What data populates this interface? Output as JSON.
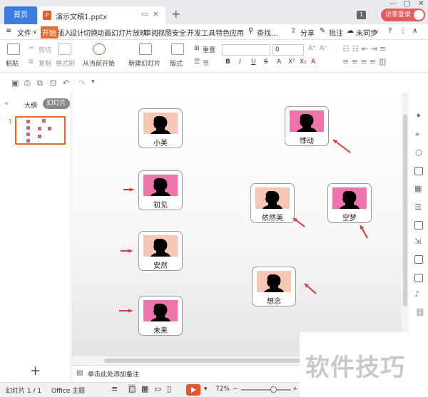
{
  "titlebar": {
    "home_tab": "首页",
    "doc_tab": "演示文稿1.pptx",
    "window_badge": "1",
    "login": "访客登录"
  },
  "menu": {
    "file": "文件",
    "items": [
      "开始",
      "插入",
      "设计",
      "切换",
      "动画",
      "幻灯片放映",
      "审阅",
      "视图",
      "安全",
      "开发工具",
      "特色应用"
    ],
    "search": "查找...",
    "share": "分享",
    "comment": "批注",
    "sync": "未同步"
  },
  "ribbon": {
    "paste": "粘贴",
    "cut": "剪切",
    "copy": "复制",
    "format_painter": "格式刷",
    "from_current": "从当前开始",
    "new_slide": "新建幻灯片",
    "layout": "版式",
    "section": "节",
    "reset": "重置",
    "font_size": "0",
    "font_buttons": [
      "B",
      "I",
      "U",
      "S",
      "A",
      "X²",
      "X₂",
      "A"
    ]
  },
  "left_panel": {
    "outline": "大纲",
    "slides": "幻灯片",
    "slide_number": "1"
  },
  "slide": {
    "cards": [
      {
        "name": "小美",
        "color": "peach"
      },
      {
        "name": "初见",
        "color": "pink"
      },
      {
        "name": "安然",
        "color": "peach"
      },
      {
        "name": "未来",
        "color": "pink"
      },
      {
        "name": "悸动",
        "color": "pink"
      },
      {
        "name": "依然美",
        "color": "peach"
      },
      {
        "name": "空梦",
        "color": "pink"
      },
      {
        "name": "想念",
        "color": "peach"
      }
    ],
    "arrow_color": "#e0353a"
  },
  "notes": {
    "placeholder": "单击此处添加备注"
  },
  "status": {
    "slide_info": "幻灯片 1 / 1",
    "theme": "Office 主题",
    "zoom": "72%"
  },
  "watermark": "软件技巧",
  "colors": {
    "accent": "#e96a2a",
    "home_tab": "#3b7ee0",
    "login": "#e85b5b",
    "peach": "#f6c5b4",
    "pink": "#ef74ad"
  }
}
